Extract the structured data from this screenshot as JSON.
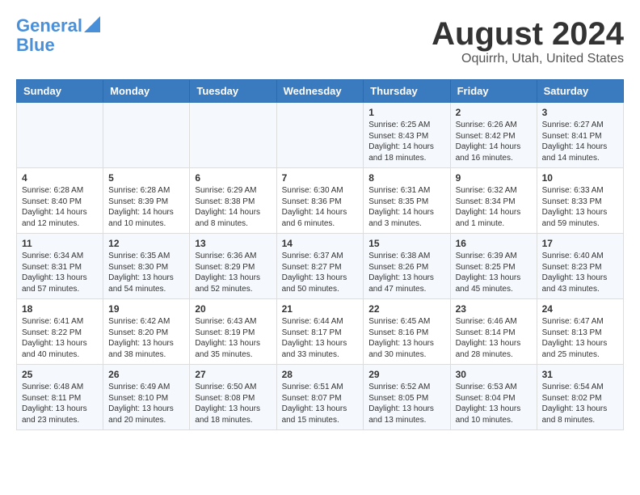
{
  "header": {
    "logo_line1": "General",
    "logo_line2": "Blue",
    "month": "August 2024",
    "location": "Oquirrh, Utah, United States"
  },
  "days_of_week": [
    "Sunday",
    "Monday",
    "Tuesday",
    "Wednesday",
    "Thursday",
    "Friday",
    "Saturday"
  ],
  "weeks": [
    [
      {
        "day": "",
        "content": ""
      },
      {
        "day": "",
        "content": ""
      },
      {
        "day": "",
        "content": ""
      },
      {
        "day": "",
        "content": ""
      },
      {
        "day": "1",
        "content": "Sunrise: 6:25 AM\nSunset: 8:43 PM\nDaylight: 14 hours\nand 18 minutes."
      },
      {
        "day": "2",
        "content": "Sunrise: 6:26 AM\nSunset: 8:42 PM\nDaylight: 14 hours\nand 16 minutes."
      },
      {
        "day": "3",
        "content": "Sunrise: 6:27 AM\nSunset: 8:41 PM\nDaylight: 14 hours\nand 14 minutes."
      }
    ],
    [
      {
        "day": "4",
        "content": "Sunrise: 6:28 AM\nSunset: 8:40 PM\nDaylight: 14 hours\nand 12 minutes."
      },
      {
        "day": "5",
        "content": "Sunrise: 6:28 AM\nSunset: 8:39 PM\nDaylight: 14 hours\nand 10 minutes."
      },
      {
        "day": "6",
        "content": "Sunrise: 6:29 AM\nSunset: 8:38 PM\nDaylight: 14 hours\nand 8 minutes."
      },
      {
        "day": "7",
        "content": "Sunrise: 6:30 AM\nSunset: 8:36 PM\nDaylight: 14 hours\nand 6 minutes."
      },
      {
        "day": "8",
        "content": "Sunrise: 6:31 AM\nSunset: 8:35 PM\nDaylight: 14 hours\nand 3 minutes."
      },
      {
        "day": "9",
        "content": "Sunrise: 6:32 AM\nSunset: 8:34 PM\nDaylight: 14 hours\nand 1 minute."
      },
      {
        "day": "10",
        "content": "Sunrise: 6:33 AM\nSunset: 8:33 PM\nDaylight: 13 hours\nand 59 minutes."
      }
    ],
    [
      {
        "day": "11",
        "content": "Sunrise: 6:34 AM\nSunset: 8:31 PM\nDaylight: 13 hours\nand 57 minutes."
      },
      {
        "day": "12",
        "content": "Sunrise: 6:35 AM\nSunset: 8:30 PM\nDaylight: 13 hours\nand 54 minutes."
      },
      {
        "day": "13",
        "content": "Sunrise: 6:36 AM\nSunset: 8:29 PM\nDaylight: 13 hours\nand 52 minutes."
      },
      {
        "day": "14",
        "content": "Sunrise: 6:37 AM\nSunset: 8:27 PM\nDaylight: 13 hours\nand 50 minutes."
      },
      {
        "day": "15",
        "content": "Sunrise: 6:38 AM\nSunset: 8:26 PM\nDaylight: 13 hours\nand 47 minutes."
      },
      {
        "day": "16",
        "content": "Sunrise: 6:39 AM\nSunset: 8:25 PM\nDaylight: 13 hours\nand 45 minutes."
      },
      {
        "day": "17",
        "content": "Sunrise: 6:40 AM\nSunset: 8:23 PM\nDaylight: 13 hours\nand 43 minutes."
      }
    ],
    [
      {
        "day": "18",
        "content": "Sunrise: 6:41 AM\nSunset: 8:22 PM\nDaylight: 13 hours\nand 40 minutes."
      },
      {
        "day": "19",
        "content": "Sunrise: 6:42 AM\nSunset: 8:20 PM\nDaylight: 13 hours\nand 38 minutes."
      },
      {
        "day": "20",
        "content": "Sunrise: 6:43 AM\nSunset: 8:19 PM\nDaylight: 13 hours\nand 35 minutes."
      },
      {
        "day": "21",
        "content": "Sunrise: 6:44 AM\nSunset: 8:17 PM\nDaylight: 13 hours\nand 33 minutes."
      },
      {
        "day": "22",
        "content": "Sunrise: 6:45 AM\nSunset: 8:16 PM\nDaylight: 13 hours\nand 30 minutes."
      },
      {
        "day": "23",
        "content": "Sunrise: 6:46 AM\nSunset: 8:14 PM\nDaylight: 13 hours\nand 28 minutes."
      },
      {
        "day": "24",
        "content": "Sunrise: 6:47 AM\nSunset: 8:13 PM\nDaylight: 13 hours\nand 25 minutes."
      }
    ],
    [
      {
        "day": "25",
        "content": "Sunrise: 6:48 AM\nSunset: 8:11 PM\nDaylight: 13 hours\nand 23 minutes."
      },
      {
        "day": "26",
        "content": "Sunrise: 6:49 AM\nSunset: 8:10 PM\nDaylight: 13 hours\nand 20 minutes."
      },
      {
        "day": "27",
        "content": "Sunrise: 6:50 AM\nSunset: 8:08 PM\nDaylight: 13 hours\nand 18 minutes."
      },
      {
        "day": "28",
        "content": "Sunrise: 6:51 AM\nSunset: 8:07 PM\nDaylight: 13 hours\nand 15 minutes."
      },
      {
        "day": "29",
        "content": "Sunrise: 6:52 AM\nSunset: 8:05 PM\nDaylight: 13 hours\nand 13 minutes."
      },
      {
        "day": "30",
        "content": "Sunrise: 6:53 AM\nSunset: 8:04 PM\nDaylight: 13 hours\nand 10 minutes."
      },
      {
        "day": "31",
        "content": "Sunrise: 6:54 AM\nSunset: 8:02 PM\nDaylight: 13 hours\nand 8 minutes."
      }
    ]
  ]
}
